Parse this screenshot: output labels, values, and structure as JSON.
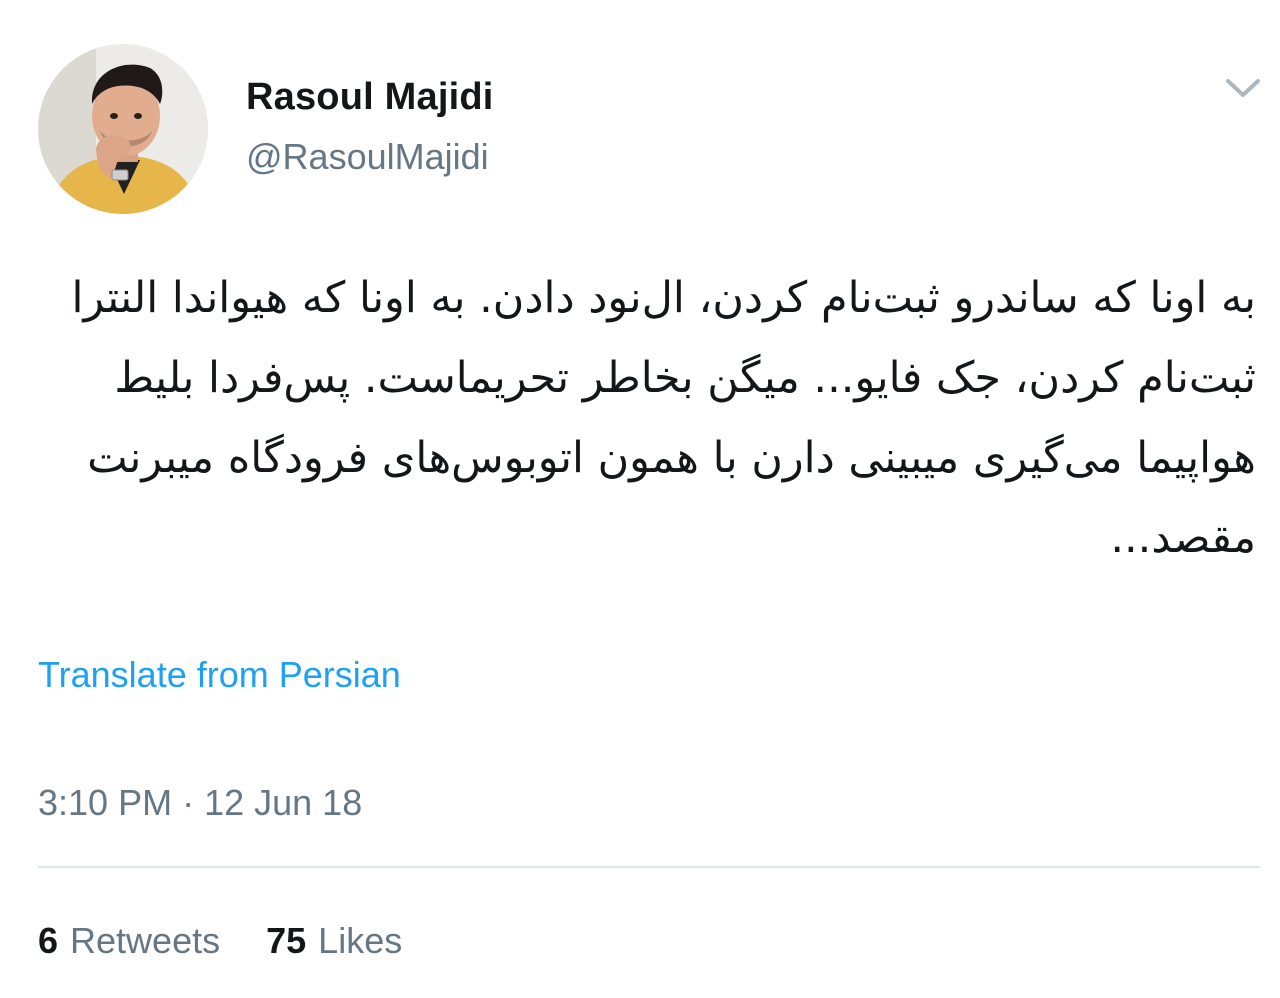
{
  "author": {
    "display_name": "Rasoul Majidi",
    "handle": "@RasoulMajidi"
  },
  "icons": {
    "menu": "chevron-down-icon",
    "avatar": "profile-photo"
  },
  "tweet": {
    "text": "به اونا که ساندرو ثبت‌نام کردن، ال‌نود دادن. به اونا که هیواندا النترا ثبت‌نام کردن، جک فایو... میگن بخاطر تحریماست. پس‌فردا بلیط هواپیما می‌گیری میبینی دارن با همون اتوبوس‌های فرودگاه میبرنت مقصد...",
    "translate_label": "Translate from Persian",
    "time": "3:10 PM",
    "separator": "·",
    "date": "12 Jun 18"
  },
  "stats": {
    "retweets_count": "6",
    "retweets_label": "Retweets",
    "likes_count": "75",
    "likes_label": "Likes"
  },
  "colors": {
    "link": "#1da1f2",
    "secondary_text": "#657786",
    "primary_text": "#14171a",
    "divider": "#e1e8ed"
  }
}
